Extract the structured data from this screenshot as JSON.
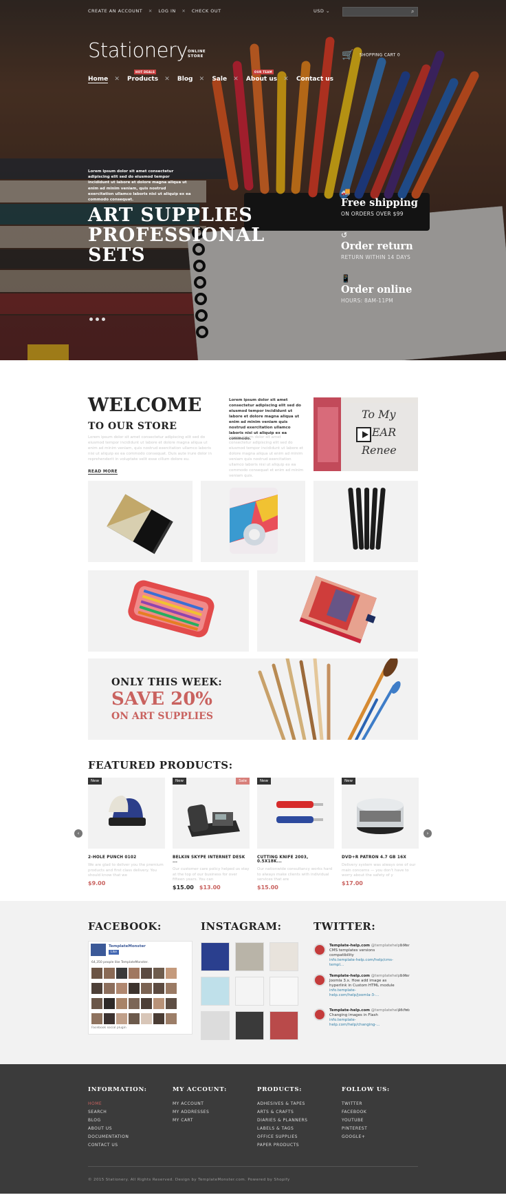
{
  "topbar": {
    "links": [
      "CREATE AN ACCOUNT",
      "LOG IN",
      "CHECK OUT"
    ],
    "currency": "USD"
  },
  "brand": {
    "logo": "Stationery",
    "sub1": "ONLINE",
    "sub2": "STORE"
  },
  "cart": {
    "label": "SHOPPING CART 0"
  },
  "nav": [
    {
      "label": "Home",
      "badge": ""
    },
    {
      "label": "Products",
      "badge": "HOT DEALS"
    },
    {
      "label": "Blog",
      "badge": ""
    },
    {
      "label": "Sale",
      "badge": ""
    },
    {
      "label": "About us",
      "badge": "OUR TEAM"
    },
    {
      "label": "Contact us",
      "badge": ""
    }
  ],
  "hero": {
    "small_text": "Lorem ipsum dolor sit amet consectetur adipiscing elit sed do eiusmod tempor incididunt ut labore et dolore magna aliqua ut enim ad minim veniam, quis nostrud exercitation ullamco laboris nisi ut aliquip ex ea commodo consequat.",
    "title1": "ART SUPPLIES",
    "title2": "PROFESSIONAL",
    "title3": "SETS",
    "benefits": [
      {
        "title": "Free shipping",
        "sub": "ON ORDERS OVER $99"
      },
      {
        "title": "Order return",
        "sub": "RETURN WITHIN 14 DAYS"
      },
      {
        "title": "Order online",
        "sub": "HOURS: 8AM-11PM"
      }
    ]
  },
  "welcome": {
    "h1": "WELCOME",
    "h2": "TO OUR STORE",
    "p1": "Lorem ipsum dolor sit amet consectetur adipiscing elit sed do eiusmod tempor incididunt ut labore et dolore magna aliqua ut enim ad minim veniam, quis nostrud exercitation ullamco laboris nisi ut aliquip ex ea commodo consequat. Duis aute irure dolor in reprehenderit in voluptate velit esse cillum dolore eu.",
    "more": "READ MORE",
    "p2": "Lorem ipsum dolor sit amet consectetur adipiscing elit sed do eiusmod tempor incididunt ut labore et dolore magna aliqua ut enim ad minim veniam quis nostrud exercitation ullamco laboris nisi ut aliquip ex ea commodo.",
    "p3": "Lorem ipsum dolor sit amet consectetur adipiscing elit sed do eiusmod tempor incididunt ut labore et dolore magna aliqua ut enim ad minim veniam quis nostrud exercitation ullamco laboris nisi ut aliquip ex ea commodo consequat et enim ad minim veniam quis."
  },
  "promo": {
    "line1": "ONLY THIS WEEK:",
    "line2": "SAVE 20%",
    "line3": "ON ART SUPPLIES"
  },
  "featured": {
    "title": "FEATURED PRODUCTS:",
    "products": [
      {
        "tag": "New",
        "sale": "",
        "name": "2-HOLE PUNCH 0102",
        "desc": "We are glad to deliver you the premium products and first class delivery. You should know that we",
        "old_price": "",
        "price": "$9.00"
      },
      {
        "tag": "New",
        "sale": "Sale",
        "name": "BELKIN SKYPE INTERNET DESK ...",
        "desc": "Our customer care policy helped us stay at the top of our business for over fifteen years. You can",
        "old_price": "$15.00",
        "price": "$13.00"
      },
      {
        "tag": "New",
        "sale": "",
        "name": "CUTTING KNIFE 2003, 0.5X18K...",
        "desc": "Our nationwide consultancy works hard to always make clients with individual services that are",
        "old_price": "",
        "price": "$15.00"
      },
      {
        "tag": "New",
        "sale": "",
        "name": "DVD+R PATRON 4.7 GB 16X",
        "desc": "Delivery system was always one of our main concerns — you don't have to worry about the safety of y",
        "old_price": "",
        "price": "$17.00"
      }
    ]
  },
  "social": {
    "facebook": {
      "title": "FACEBOOK:",
      "page": "TemplateMonster",
      "like": "Like",
      "count": "64,350 people like TemplateMonster.",
      "plugin": "Facebook social plugin"
    },
    "instagram": {
      "title": "INSTAGRAM:"
    },
    "twitter": {
      "title": "TWITTER:",
      "tweets": [
        {
          "name": "Template-help.com",
          "handle": "@templatehelpcom",
          "date": "9 Mar",
          "text": "CMS templates versions compatibility",
          "link": "info.template-help.com/help/cms-templ..."
        },
        {
          "name": "Template-help.com",
          "handle": "@templatehelpcom",
          "date": "9 Mar",
          "text": "Joomla 3.x. How add image as hyperlink in Custom HTML module",
          "link": "info.template-help.com/help/joomla-3-..."
        },
        {
          "name": "Template-help.com",
          "handle": "@templatehelpcom",
          "date": "26 Feb",
          "text": "Changing images in Flash",
          "link": "info.template-help.com/help/changing-..."
        }
      ]
    }
  },
  "footer": {
    "columns": [
      {
        "title": "INFORMATION:",
        "items": [
          "HOME",
          "SEARCH",
          "BLOG",
          "ABOUT US",
          "DOCUMENTATION",
          "CONTACT US"
        ]
      },
      {
        "title": "MY ACCOUNT:",
        "items": [
          "MY ACCOUNT",
          "MY ADDRESSES",
          "MY CART"
        ]
      },
      {
        "title": "PRODUCTS:",
        "items": [
          "ADHESIVES & TAPES",
          "ARTS & CRAFTS",
          "DIARIES & PLANNERS",
          "LABELS & TAGS",
          "OFFICE SUPPLIES",
          "PAPER PRODUCTS"
        ]
      },
      {
        "title": "FOLLOW US:",
        "items": [
          "TWITTER",
          "FACEBOOK",
          "YOUTUBE",
          "PINTEREST",
          "GOOGLE+"
        ]
      }
    ],
    "copyright": "© 2015 Stationery. All Rights Reserved. Design by TemplateMonster.com. Powered by Shopify"
  },
  "colors": {
    "accent": "#c9625f",
    "dark": "#3b3b3b",
    "light_bg": "#f2f2f2"
  }
}
